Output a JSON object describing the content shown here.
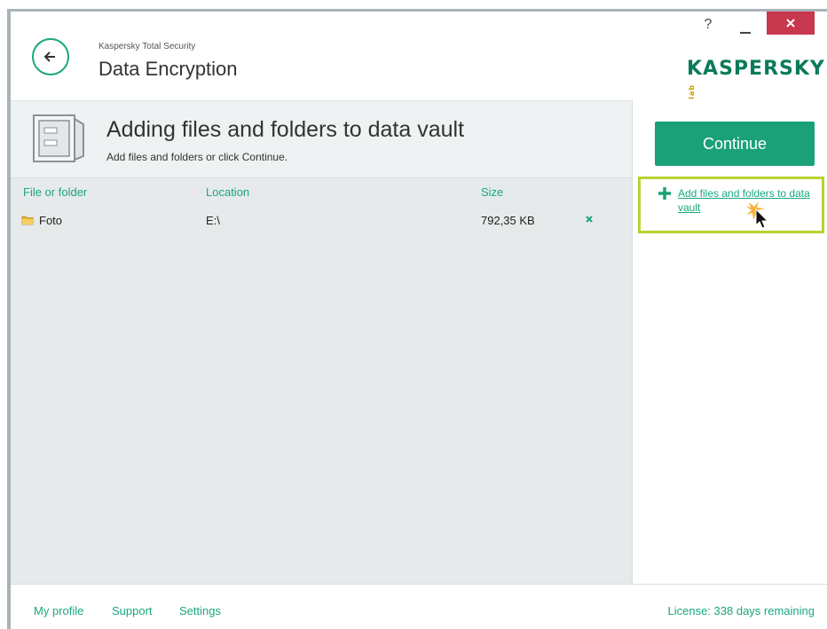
{
  "header": {
    "app_name": "Kaspersky Total Security",
    "section_title": "Data Encryption",
    "help_label": "?",
    "logo_text": "KASPERSKY",
    "logo_sub": "lab"
  },
  "vault": {
    "title": "Adding files and folders to data vault",
    "subtitle": "Add files and folders or click Continue."
  },
  "table": {
    "columns": [
      "File or folder",
      "Location",
      "Size"
    ],
    "rows": [
      {
        "name": "Foto",
        "location": "E:\\",
        "size": "792,35 KB",
        "remove_label": "×"
      }
    ]
  },
  "right_panel": {
    "continue_label": "Continue",
    "add_link_label": "Add files and folders to data vault"
  },
  "footer": {
    "links": [
      "My profile",
      "Support",
      "Settings"
    ],
    "license": "License: 338 days remaining"
  },
  "colors": {
    "accent": "#1aa178",
    "link": "#19a77e",
    "close": "#c7384f",
    "highlight": "#b6d42e"
  }
}
